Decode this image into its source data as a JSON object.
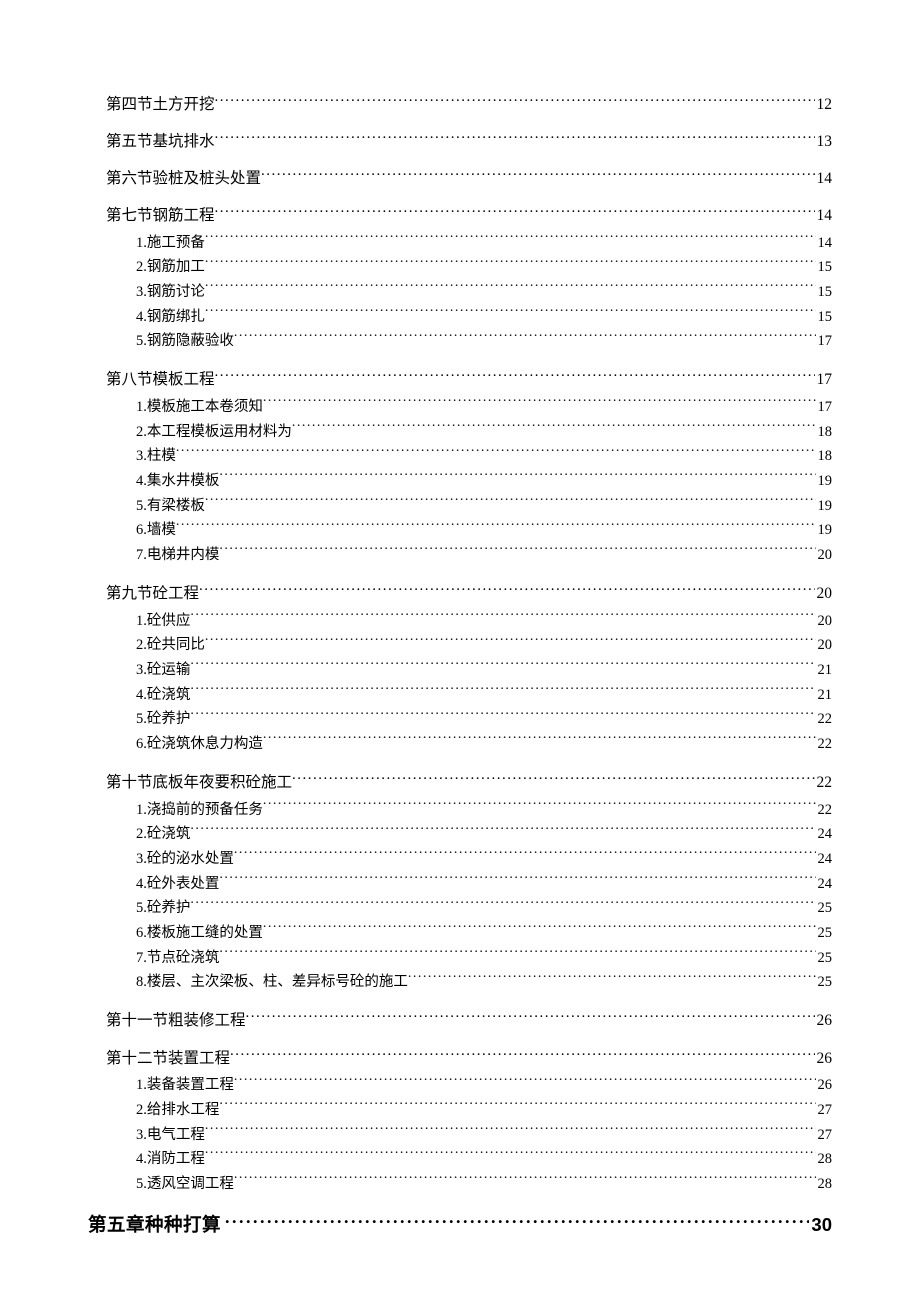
{
  "toc": [
    {
      "level": "section",
      "label": "第四节土方开挖",
      "page": "12"
    },
    {
      "level": "section",
      "label": "第五节基坑排水",
      "page": "13"
    },
    {
      "level": "section",
      "label": "第六节验桩及桩头处置",
      "page": "14"
    },
    {
      "level": "section",
      "label": "第七节钢筋工程",
      "page": "14"
    },
    {
      "level": "sub",
      "label": "1.施工预备",
      "page": "14"
    },
    {
      "level": "sub",
      "label": "2.钢筋加工",
      "page": "15"
    },
    {
      "level": "sub",
      "label": "3.钢筋讨论",
      "page": "15"
    },
    {
      "level": "sub",
      "label": "4.钢筋绑扎",
      "page": "15"
    },
    {
      "level": "sub",
      "label": "5.钢筋隐蔽验收",
      "page": "17"
    },
    {
      "level": "section",
      "label": "第八节模板工程",
      "page": "17"
    },
    {
      "level": "sub",
      "label": "1.模板施工本卷须知",
      "page": "17"
    },
    {
      "level": "sub",
      "label": "2.本工程模板运用材料为",
      "page": "18"
    },
    {
      "level": "sub",
      "label": "3.柱模",
      "page": "18"
    },
    {
      "level": "sub",
      "label": "4.集水井模板",
      "page": "19"
    },
    {
      "level": "sub",
      "label": "5.有梁楼板",
      "page": "19"
    },
    {
      "level": "sub",
      "label": "6.墙模",
      "page": "19"
    },
    {
      "level": "sub",
      "label": "7.电梯井内模",
      "page": "20"
    },
    {
      "level": "section",
      "label": "第九节砼工程",
      "page": "20"
    },
    {
      "level": "sub",
      "label": "1.砼供应",
      "page": "20"
    },
    {
      "level": "sub",
      "label": "2.砼共同比",
      "page": "20"
    },
    {
      "level": "sub",
      "label": "3.砼运输",
      "page": "21"
    },
    {
      "level": "sub",
      "label": "4.砼浇筑",
      "page": "21"
    },
    {
      "level": "sub",
      "label": "5.砼养护",
      "page": "22"
    },
    {
      "level": "sub",
      "label": "6.砼浇筑休息力构造",
      "page": "22"
    },
    {
      "level": "section",
      "label": "第十节底板年夜要积砼施工",
      "page": "22"
    },
    {
      "level": "sub",
      "label": "1.浇捣前的预备任务",
      "page": "22"
    },
    {
      "level": "sub",
      "label": "2.砼浇筑",
      "page": "24"
    },
    {
      "level": "sub",
      "label": "3.砼的泌水处置",
      "page": "24"
    },
    {
      "level": "sub",
      "label": "4.砼外表处置",
      "page": "24"
    },
    {
      "level": "sub",
      "label": "5.砼养护",
      "page": "25"
    },
    {
      "level": "sub",
      "label": "6.楼板施工缝的处置",
      "page": "25"
    },
    {
      "level": "sub",
      "label": "7.节点砼浇筑",
      "page": "25"
    },
    {
      "level": "sub",
      "label": "8.楼层、主次梁板、柱、差异标号砼的施工",
      "page": "25"
    },
    {
      "level": "section",
      "label": "第十一节粗装修工程",
      "page": "26"
    },
    {
      "level": "section",
      "label": "第十二节装置工程",
      "page": "26"
    },
    {
      "level": "sub",
      "label": "1.装备装置工程",
      "page": "26"
    },
    {
      "level": "sub",
      "label": "2.给排水工程",
      "page": "27"
    },
    {
      "level": "sub",
      "label": "3.电气工程",
      "page": "27"
    },
    {
      "level": "sub",
      "label": "4.消防工程",
      "page": "28"
    },
    {
      "level": "sub",
      "label": "5.透风空调工程",
      "page": "28"
    },
    {
      "level": "chapter",
      "label": "第五章种种打算",
      "page": "30"
    }
  ]
}
